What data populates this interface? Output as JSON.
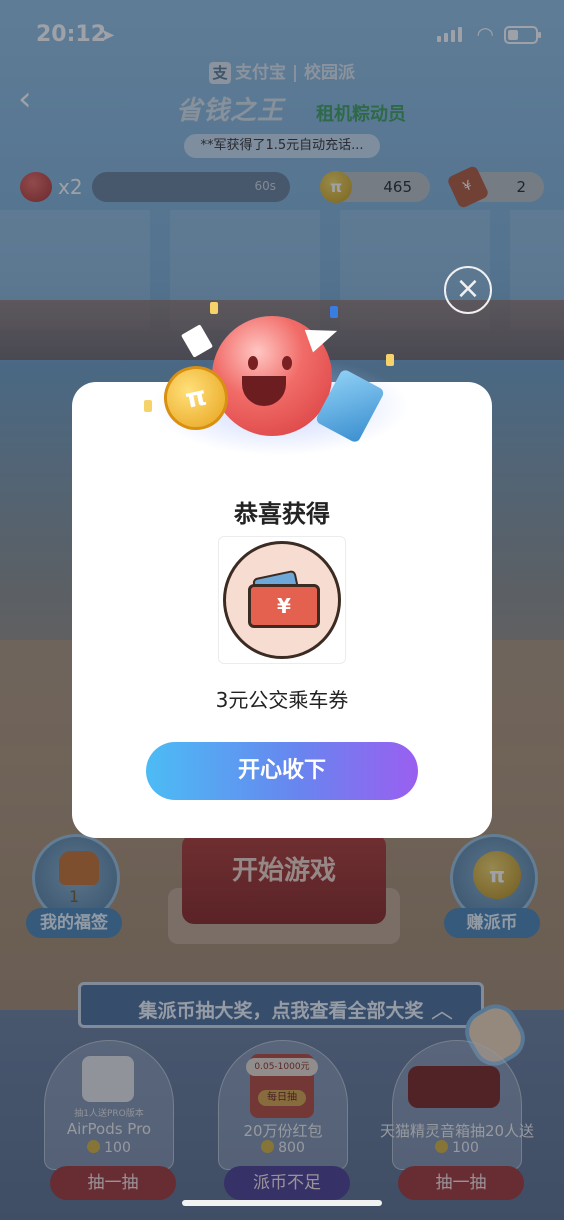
{
  "status_bar": {
    "time": "20:12"
  },
  "header": {
    "brand": "支付宝",
    "brand_sub": "校园派",
    "game_title": "省钱之王",
    "game_sub": "租机粽动员",
    "ticker": "**军获得了1.5元自动充话..."
  },
  "stats": {
    "lives": "x2",
    "timer": "60s",
    "coins": "465",
    "tickets": "2"
  },
  "modal": {
    "title": "恭喜获得",
    "prize_name": "3元公交乘车券",
    "voucher_symbol": "¥",
    "coin_symbol": "π",
    "accept_label": "开心收下",
    "close_symbol": "×"
  },
  "game": {
    "start_label": "开始游戏",
    "fortune_label": "我的福签",
    "fortune_count": "1",
    "earn_label": "赚派币",
    "earn_symbol": "π",
    "prize_banner": "集派币抽大奖，点我查看全部大奖"
  },
  "prizes": [
    {
      "sub": "抽1人送PRO版本",
      "name": "AirPods Pro",
      "cost": "100",
      "button": "抽一抽",
      "state": "active"
    },
    {
      "tag": "0.05-1000元",
      "day": "每日抽",
      "name": "20万份红包",
      "cost": "800",
      "button": "派币不足",
      "state": "insufficient"
    },
    {
      "name": "天猫精灵音箱抽20人送",
      "cost": "100",
      "button": "抽一抽",
      "state": "active"
    }
  ],
  "colors": {
    "accept_gradient_start": "#4cbcf5",
    "accept_gradient_end": "#9a5ff0",
    "mascot": "#f16c68",
    "coin": "#e7a31d"
  }
}
